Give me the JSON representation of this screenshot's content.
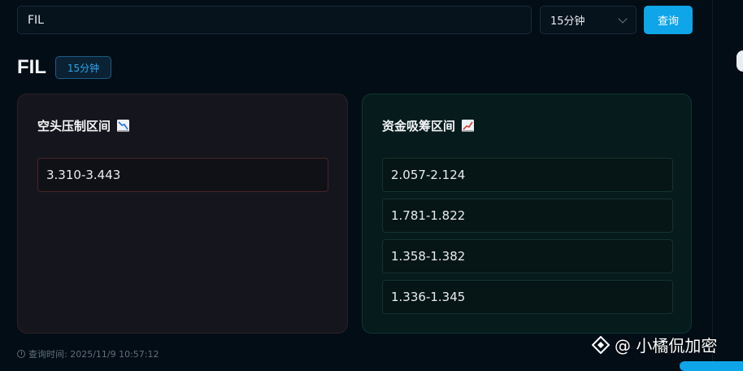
{
  "search": {
    "value": "FIL"
  },
  "interval_select": {
    "selected": "15分钟"
  },
  "query_button": {
    "label": "查询"
  },
  "header": {
    "symbol": "FIL",
    "interval_tag": "15分钟"
  },
  "short_panel": {
    "title": "空头压制区间",
    "icon": "chart-decreasing-icon",
    "zones": [
      "3.310-3.443"
    ]
  },
  "long_panel": {
    "title": "资金吸筹区间",
    "icon": "chart-increasing-icon",
    "zones": [
      "2.057-2.124",
      "1.781-1.822",
      "1.358-1.382",
      "1.336-1.345"
    ]
  },
  "footer": {
    "query_time": "查询时间: 2025/11/9 10:57:12"
  },
  "watermark": {
    "text": "@ 小橘侃加密"
  },
  "colors": {
    "accent": "#0fa5e9",
    "short_border": "#4a2326",
    "long_border": "#143331"
  }
}
